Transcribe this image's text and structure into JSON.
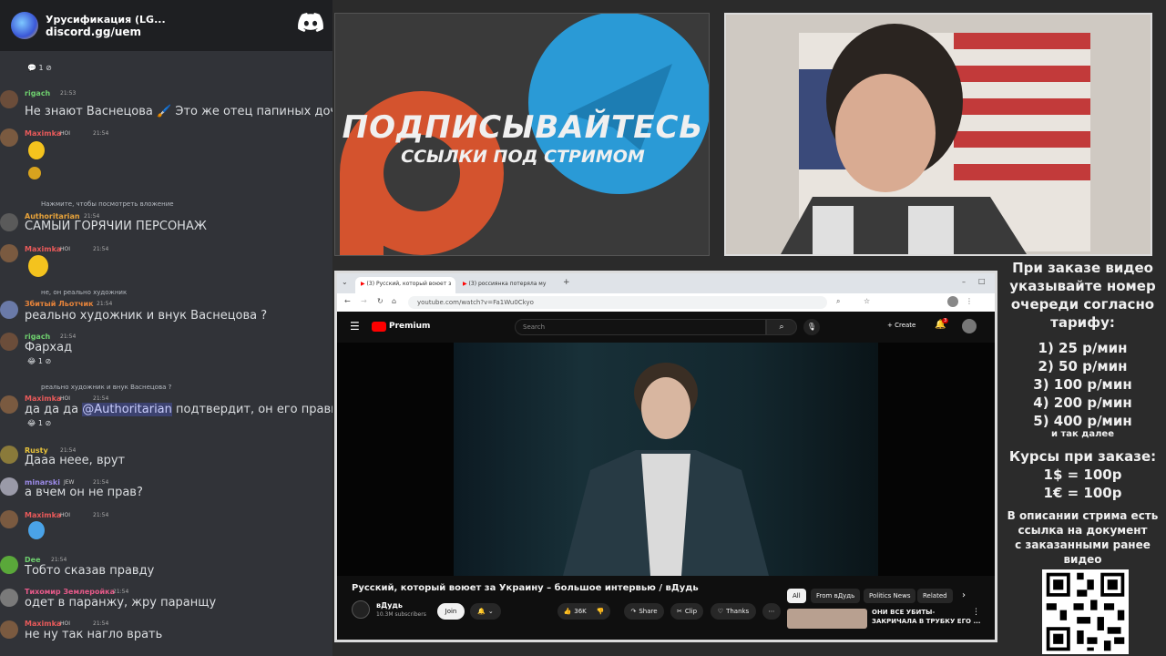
{
  "discord": {
    "server_name": "Урусификация (LG...",
    "invite": "discord.gg/uem",
    "messages": [
      {
        "user": "rigach",
        "time": "21:53",
        "text": "Не знают Васнецова",
        "text2": "Это же отец папиных дочек",
        "color": "#6ecf6e"
      },
      {
        "user": "Maximka",
        "time": "21:54",
        "text": "",
        "color": "#e85a5a"
      },
      {
        "reply": "Нажмите, чтобы посмотреть вложение",
        "user": "Authoritarian",
        "time": "21:54",
        "text": "САМЫИ ГОРЯЧИИ ПЕРСОНАЖ",
        "color": "#e8a33a"
      },
      {
        "user": "Maximka",
        "time": "21:54",
        "text": "",
        "color": "#e85a5a"
      },
      {
        "reply": "не, он реально художник",
        "user": "Збитый Льотчик",
        "time": "21:54",
        "text": "реально художник и внук Васнецова ?",
        "color": "#e8843a"
      },
      {
        "user": "rigach",
        "time": "21:54",
        "text": "Фархад",
        "color": "#6ecf6e"
      },
      {
        "reply": "реально художник и внук Васнецова ?",
        "user": "Maximka",
        "time": "21:54",
        "text": "да да да",
        "mention": "@Authoritarian",
        "text2": "подтвердит, он его правнук",
        "color": "#e85a5a"
      },
      {
        "user": "Rusty",
        "time": "21:54",
        "text": "Дааа неее, врут",
        "color": "#e8c33a"
      },
      {
        "user": "minarski",
        "time": "21:54",
        "text": "а вчем он не прав?",
        "color": "#9b8ae8"
      },
      {
        "user": "Maximka",
        "time": "21:54",
        "text": "",
        "color": "#e85a5a"
      },
      {
        "user": "Dee",
        "time": "21:54",
        "text": "Тобто сказав правду",
        "color": "#6ecf6e"
      },
      {
        "user": "Тихомир Землеройка",
        "time": "21:54",
        "text": "одет в паранжу, жру паранщу",
        "color": "#e85a8a"
      },
      {
        "user": "Maximka",
        "time": "21:54",
        "text": "не ну так нагло врать",
        "color": "#e85a5a"
      }
    ],
    "badge_hoi": "HOI",
    "badge_jew": "JEW",
    "reaction_count": "1"
  },
  "banner": {
    "title": "ПОДПИСЫВАЙТЕСЬ",
    "subtitle": "ССЫЛКИ ПОД СТРИМОМ"
  },
  "browser": {
    "tab1": "(3) Русский, который воюет з",
    "tab2": "(3) россиянка потеряла му",
    "url": "youtube.com/watch?v=Fa1Wu0Ckyo",
    "yt_logo": "Premium",
    "search_placeholder": "Search",
    "create": "Create",
    "notif_count": "3",
    "video_title": "Русский, который воюет за Украину – большое интервью / вДудь",
    "channel": "вДудь",
    "subscribers": "10.3M subscribers",
    "join": "Join",
    "likes": "36K",
    "share": "Share",
    "clip": "Clip",
    "thanks": "Thanks",
    "chips": [
      "All",
      "From вДудь",
      "Politics News",
      "Related"
    ],
    "rec_title_1": "ОНИ ВСЕ УБИТЫ-",
    "rec_title_2": "ЗАКРИЧАЛА В ТРУБКУ ЕГО ..."
  },
  "info": {
    "l1": "При заказе видео",
    "l2": "указывайте номер",
    "l3": "очереди согласно",
    "l4": "тарифу:",
    "t1": "1) 25 р/мин",
    "t2": "2) 50 р/мин",
    "t3": "3) 100 р/мин",
    "t4": "4) 200 р/мин",
    "t5": "5) 400 р/мин",
    "etc": "и так далее",
    "r1": "Курсы при заказе:",
    "r2": "1$ = 100р",
    "r3": "1€ = 100р",
    "d1": "В описании стрима есть",
    "d2": "ссылка на документ",
    "d3": "с заказанными ранее",
    "d4": "видео"
  }
}
